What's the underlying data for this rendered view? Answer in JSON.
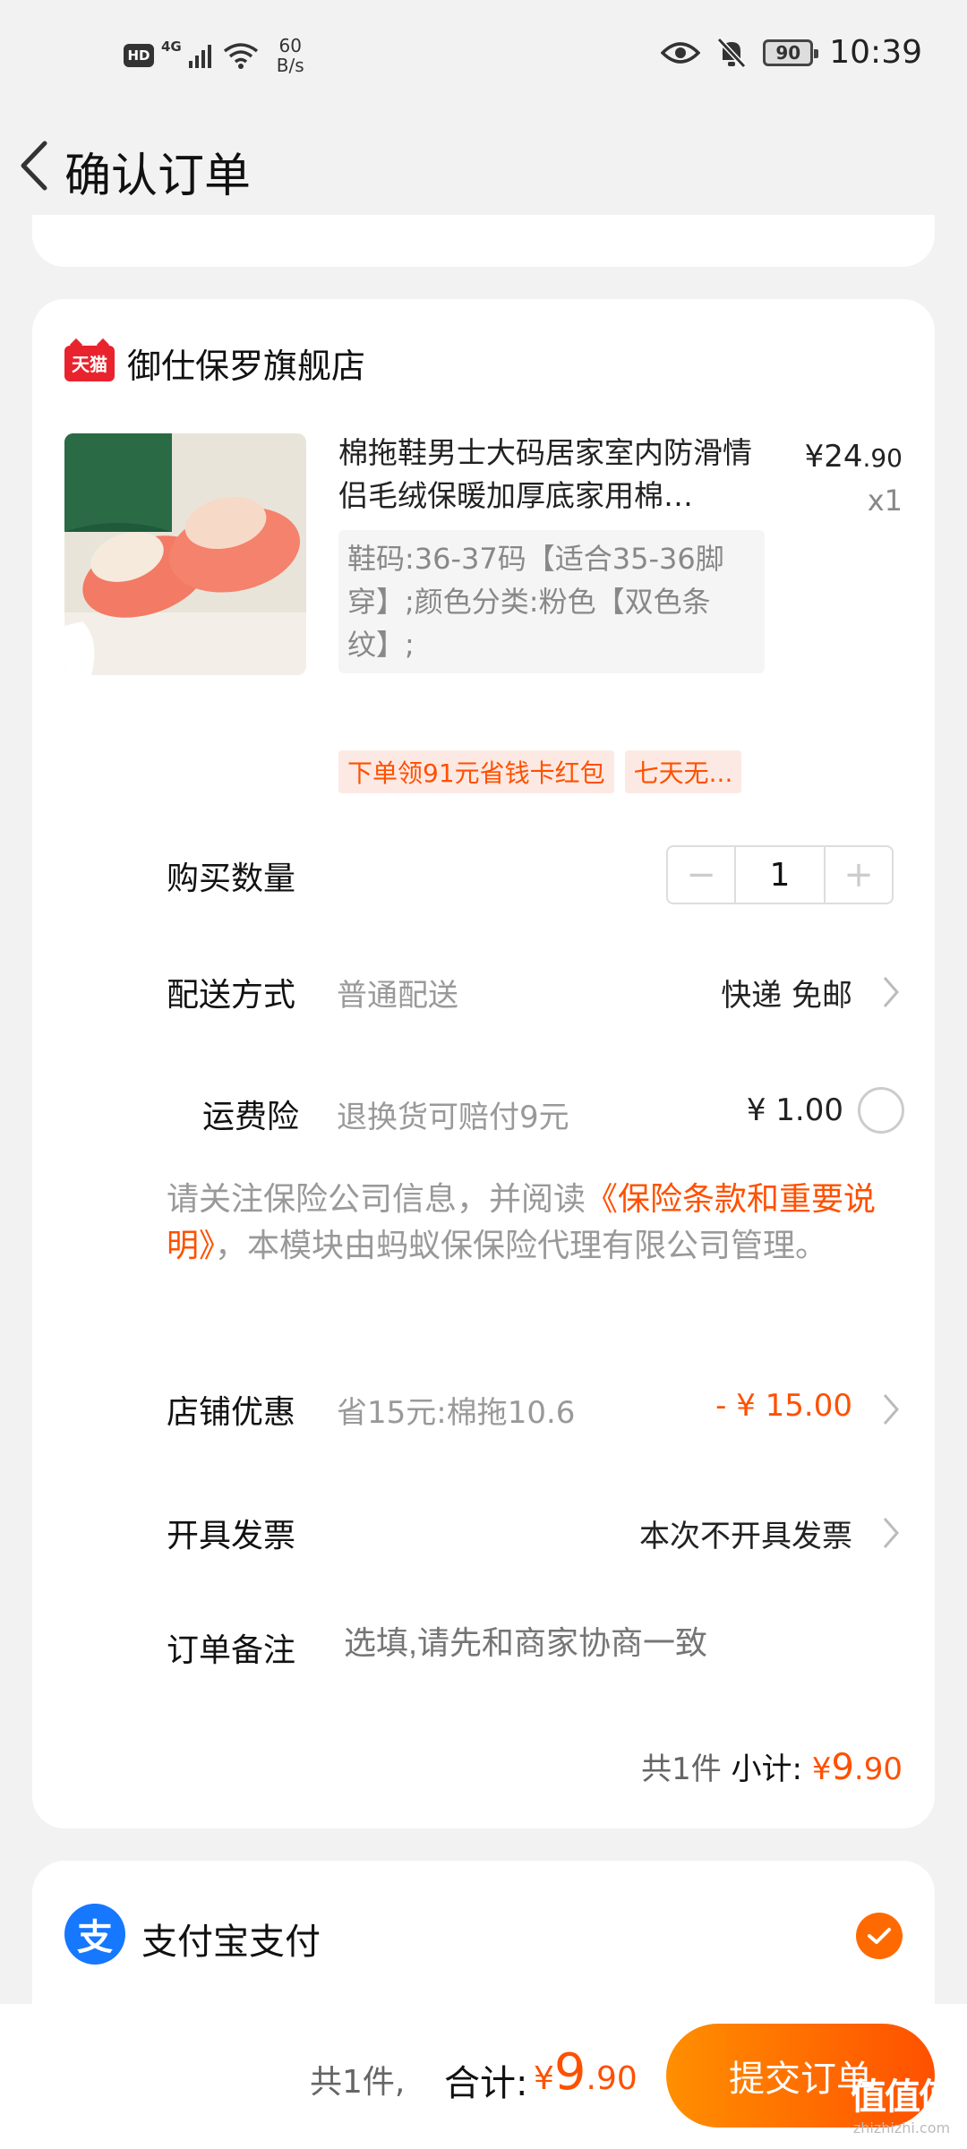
{
  "status_bar": {
    "hd": "HD",
    "network": "4G",
    "speed_value": "60",
    "speed_unit": "B/s",
    "battery": "90",
    "time": "10:39"
  },
  "nav": {
    "title": "确认订单"
  },
  "shop": {
    "logo_text": "天猫",
    "name": "御仕保罗旗舰店"
  },
  "product": {
    "title": "棉拖鞋男士大码居家室内防滑情侣毛绒保暖加厚底家用棉…",
    "price_symbol": "¥",
    "price_int": "24",
    "price_dec": ".90",
    "quantity": "x1",
    "sku": "鞋码:36-37码【适合35-36脚穿】;颜色分类:粉色【双色条纹】;"
  },
  "tags": [
    "下单领91元省钱卡红包",
    "七天无..."
  ],
  "quantity_row": {
    "label": "购买数量",
    "minus": "−",
    "value": "1",
    "plus": "+"
  },
  "delivery": {
    "label": "配送方式",
    "sub": "普通配送",
    "value": "快递 免邮"
  },
  "freight_insurance": {
    "label": "运费险",
    "sub": "退换货可赔付9元",
    "value": "¥ 1.00"
  },
  "notice": {
    "prefix": "请关注保险公司信息，并阅读",
    "link": "《保险条款和重要说明》",
    "suffix": "，本模块由蚂蚁保保险代理有限公司管理。"
  },
  "shop_discount": {
    "label": "店铺优惠",
    "sub": "省15元:棉拖10.6",
    "value": "- ¥ 15.00"
  },
  "invoice": {
    "label": "开具发票",
    "value": "本次不开具发票"
  },
  "remark": {
    "label": "订单备注",
    "placeholder": "选填,请先和商家协商一致"
  },
  "subtotal": {
    "count": "共1件",
    "label": "小计:",
    "symbol": "¥",
    "int": "9",
    "dec": ".90"
  },
  "payment": {
    "logo_text": "支",
    "label": "支付宝支付"
  },
  "bottom": {
    "count": "共1件,",
    "label": "合计:",
    "symbol": "¥",
    "int": "9",
    "dec": ".90",
    "submit": "提交订单"
  },
  "watermark": {
    "mark": "值值值",
    "text": "zhizhizhi.com"
  },
  "colors": {
    "accent": "#ff5000",
    "accent_gradient_start": "#ff8f00",
    "alipay_blue": "#1677ff",
    "tmall_red": "#e8232e"
  }
}
